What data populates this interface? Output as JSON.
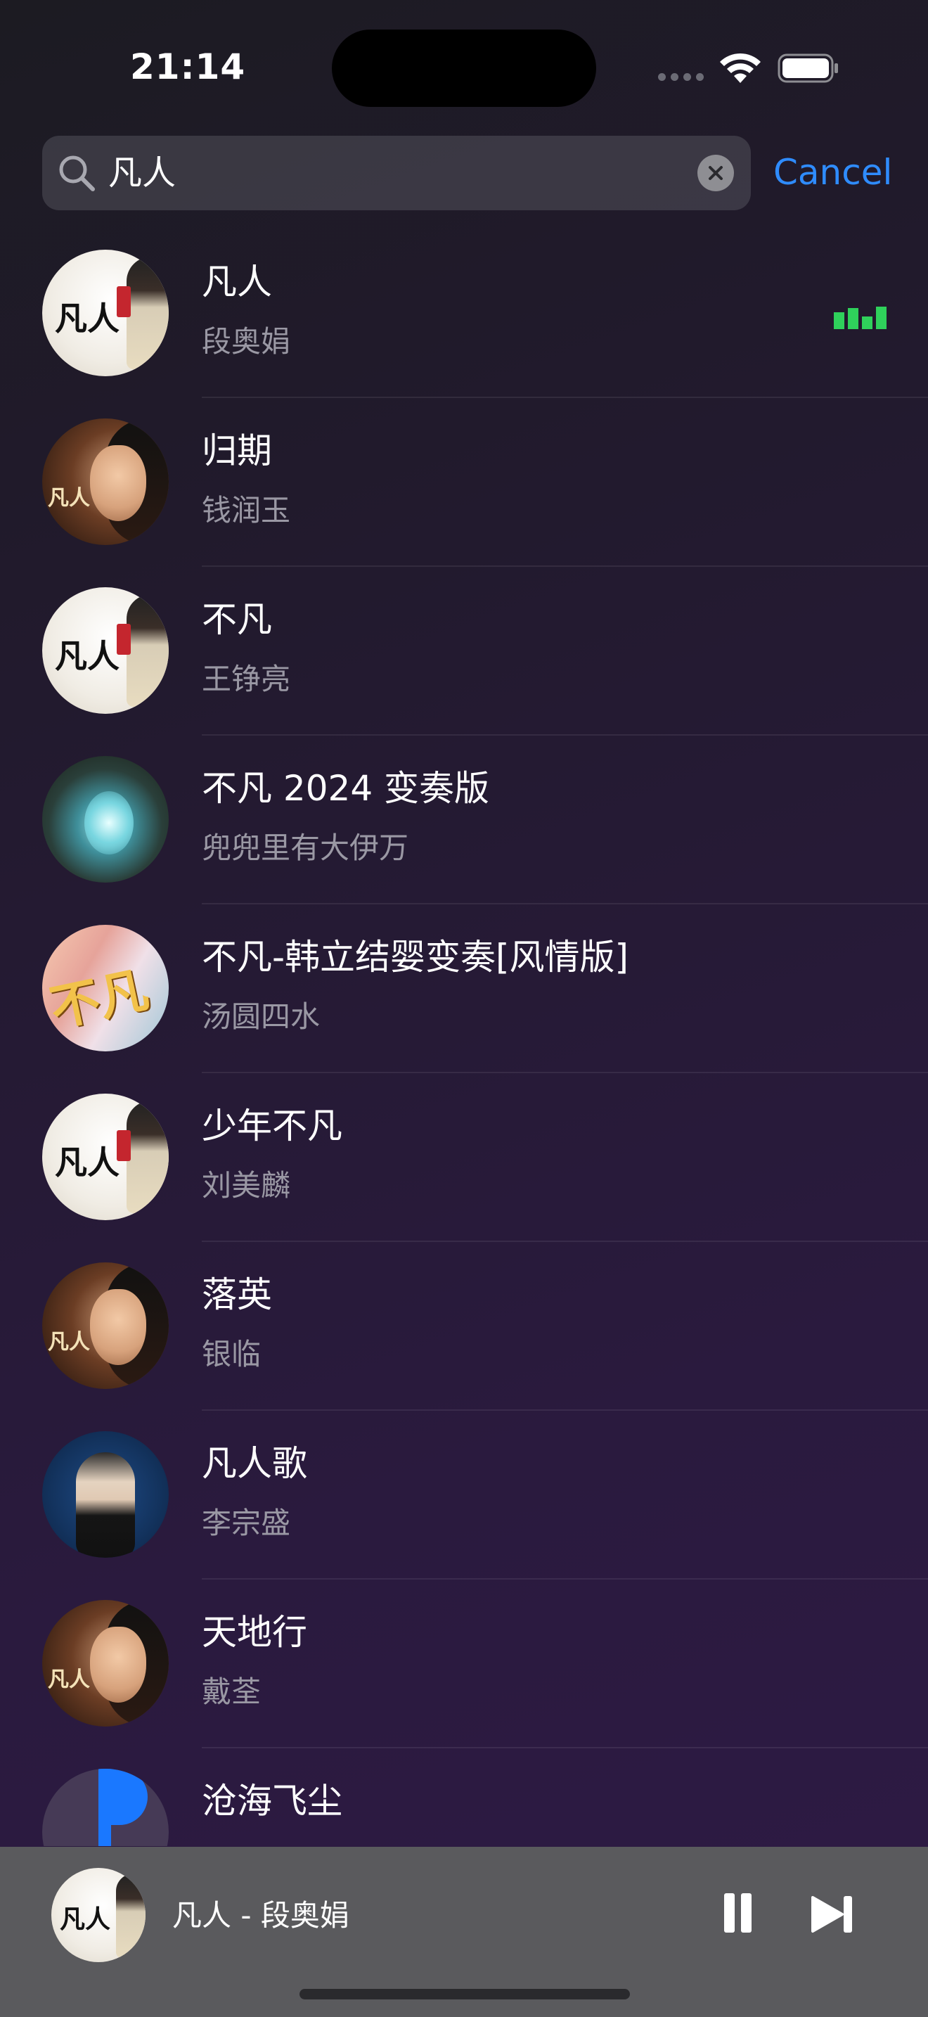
{
  "status_bar": {
    "time": "21:14"
  },
  "search": {
    "query": "凡人",
    "cancel_label": "Cancel"
  },
  "songs": [
    {
      "title": "凡人",
      "artist": "段奥娟",
      "cover": "white-calligraphy",
      "now_playing": true
    },
    {
      "title": "归期",
      "artist": "钱润玉",
      "cover": "portrait"
    },
    {
      "title": "不凡",
      "artist": "王铮亮",
      "cover": "white-calligraphy"
    },
    {
      "title": "不凡 2024 变奏版",
      "artist": "兜兜里有大伊万",
      "cover": "teal-landscape"
    },
    {
      "title": "不凡-韩立结婴变奏[风情版]",
      "artist": "汤圆四水",
      "cover": "pink-calligraphy"
    },
    {
      "title": "少年不凡",
      "artist": "刘美麟",
      "cover": "white-calligraphy"
    },
    {
      "title": "落英",
      "artist": "银临",
      "cover": "portrait"
    },
    {
      "title": "凡人歌",
      "artist": "李宗盛",
      "cover": "blue-portrait"
    },
    {
      "title": "天地行",
      "artist": "戴荃",
      "cover": "portrait"
    },
    {
      "title": "沧海飞尘",
      "artist": "",
      "cover": "blue-flag"
    }
  ],
  "mini_player": {
    "now_playing": "凡人 - 段奥娟"
  },
  "colors": {
    "accent": "#2f8cff",
    "playing_indicator": "#2fd15b",
    "secondary_text": "#9a98a4"
  }
}
